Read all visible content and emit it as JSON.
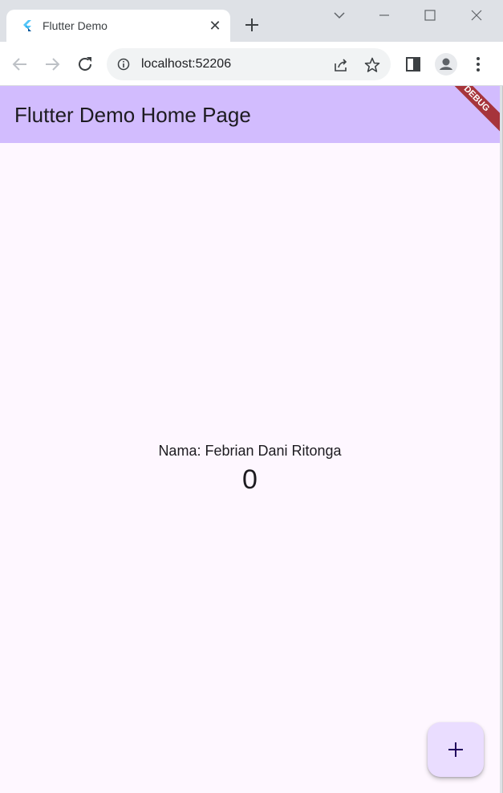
{
  "browser": {
    "tab": {
      "title": "Flutter Demo",
      "close_glyph": "✕",
      "favicon": "flutter-icon"
    },
    "address": {
      "url": "localhost:52206"
    },
    "colors": {
      "chrome": "#dee1e6",
      "omnibox": "#f1f3f4"
    }
  },
  "app": {
    "title": "Flutter Demo Home Page",
    "debug_banner": "DEBUG",
    "name_label": "Nama: Febrian Dani Ritonga",
    "counter": "0",
    "fab_icon": "add-icon",
    "colors": {
      "appbar": "#d2bcfe",
      "background": "#fef7ff",
      "fab": "#eaddff",
      "banner": "#a6343b"
    }
  }
}
